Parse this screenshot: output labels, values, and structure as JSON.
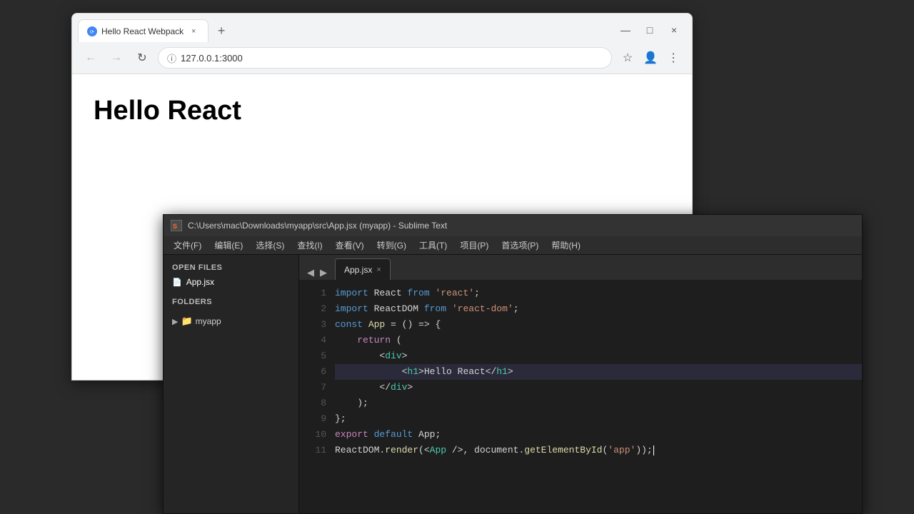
{
  "browser": {
    "tab": {
      "favicon": "⊕",
      "label": "Hello React Webpack",
      "close": "×"
    },
    "new_tab_label": "+",
    "window_controls": {
      "minimize": "—",
      "maximize": "□",
      "close": "×"
    },
    "nav": {
      "back": "←",
      "forward": "→",
      "refresh": "↻",
      "info": "ⓘ",
      "url": "127.0.0.1:3000",
      "bookmark": "☆",
      "profile": "👤",
      "menu": "⋮"
    },
    "page": {
      "heading": "Hello React"
    }
  },
  "editor": {
    "titlebar": {
      "text": "C:\\Users\\mac\\Downloads\\myapp\\src\\App.jsx (myapp) - Sublime Text"
    },
    "menubar": {
      "items": [
        "文件(F)",
        "编辑(E)",
        "选择(S)",
        "查找(I)",
        "查看(V)",
        "转到(G)",
        "工具(T)",
        "项目(P)",
        "首选项(P)",
        "帮助(H)"
      ]
    },
    "sidebar": {
      "open_files_title": "OPEN FILES",
      "open_files": [
        "App.jsx"
      ],
      "folders_title": "FOLDERS",
      "folder_name": "myapp"
    },
    "tab": {
      "name": "App.jsx",
      "close": "×",
      "nav_prev": "◀",
      "nav_next": "▶"
    },
    "code_lines": [
      {
        "num": "1",
        "content": "import React from 'react';"
      },
      {
        "num": "2",
        "content": "import ReactDOM from 'react-dom';"
      },
      {
        "num": "3",
        "content": "const App = () => {"
      },
      {
        "num": "4",
        "content": "    return ("
      },
      {
        "num": "5",
        "content": "        <div>"
      },
      {
        "num": "6",
        "content": "            <h1>Hello React</h1>",
        "highlight": true
      },
      {
        "num": "7",
        "content": "        </div>"
      },
      {
        "num": "8",
        "content": "    );"
      },
      {
        "num": "9",
        "content": "};"
      },
      {
        "num": "10",
        "content": "export default App;"
      },
      {
        "num": "11",
        "content": "ReactDOM.render(<App />, document.getElementById('app'));"
      }
    ]
  }
}
